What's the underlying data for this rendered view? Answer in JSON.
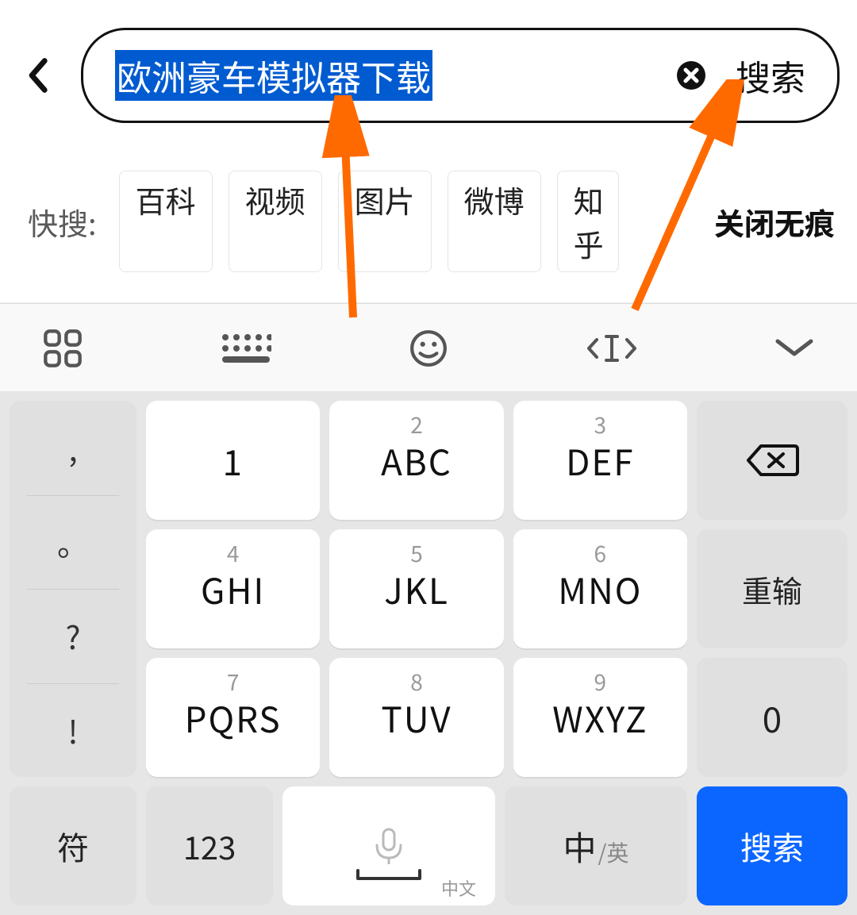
{
  "search": {
    "value": "欧洲豪车模拟器下载",
    "search_label": "搜索"
  },
  "quick": {
    "label": "快搜:",
    "chips": [
      "百科",
      "视频",
      "图片",
      "微博",
      "知乎"
    ],
    "right_label": "关闭无痕"
  },
  "keyboard": {
    "side_punct": [
      ",",
      "。",
      "?",
      "!"
    ],
    "keys": [
      {
        "num": "1",
        "main": "1"
      },
      {
        "num": "2",
        "main": "ABC"
      },
      {
        "num": "3",
        "main": "DEF"
      },
      {
        "num": "4",
        "main": "GHI"
      },
      {
        "num": "5",
        "main": "JKL"
      },
      {
        "num": "6",
        "main": "MNO"
      },
      {
        "num": "7",
        "main": "PQRS"
      },
      {
        "num": "8",
        "main": "TUV"
      },
      {
        "num": "9",
        "main": "WXYZ"
      }
    ],
    "fn_reinput": "重输",
    "fn_zero": "0",
    "bottom": {
      "symbol": "符",
      "num_mode": "123",
      "space_sub": "中文",
      "lang_cn": "中",
      "lang_en": "/英",
      "search": "搜索"
    }
  }
}
